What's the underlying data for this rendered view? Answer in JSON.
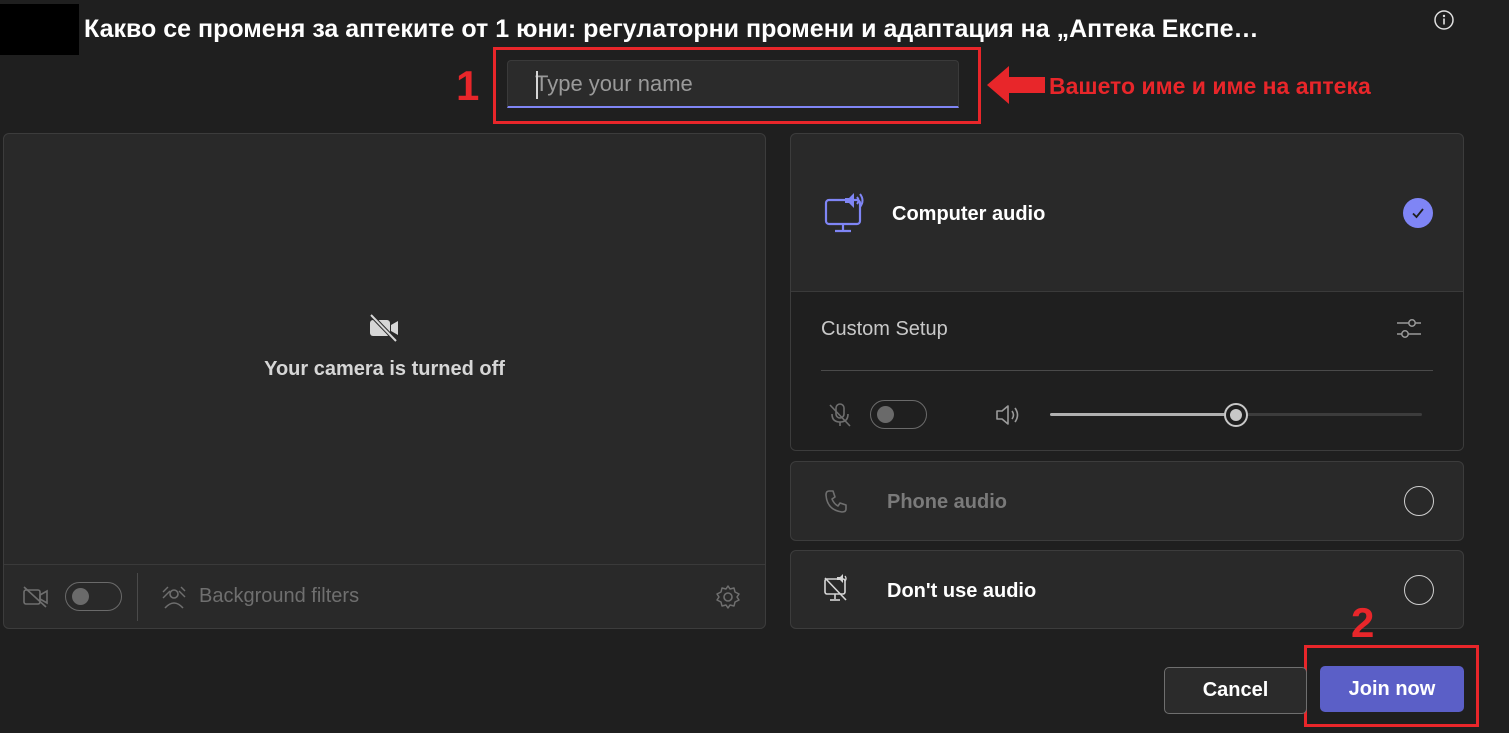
{
  "header": {
    "meeting_title": "Какво се променя за аптеките от 1 юни: регулаторни промени и адаптация на „Аптека Експе…",
    "info_icon": "info-icon"
  },
  "name_input": {
    "placeholder": "Type your name",
    "value": ""
  },
  "annotations": {
    "step1_number": "1",
    "step1_text": "Вашето име и име на аптека",
    "step2_number": "2",
    "color": "#e8262a"
  },
  "camera": {
    "off_message": "Your camera is turned off",
    "background_filters_label": "Background filters",
    "camera_toggle_on": false
  },
  "audio": {
    "computer_audio_label": "Computer audio",
    "computer_audio_selected": true,
    "custom_setup_label": "Custom Setup",
    "mic_toggle_on": false,
    "speaker_volume": 0.5,
    "phone_audio_label": "Phone audio",
    "dont_use_audio_label": "Don't use audio"
  },
  "actions": {
    "cancel_label": "Cancel",
    "join_label": "Join now"
  },
  "colors": {
    "background": "#1f1f1f",
    "panel": "#292929",
    "accent": "#5b5fc7",
    "accent_light": "#7f85f5"
  }
}
